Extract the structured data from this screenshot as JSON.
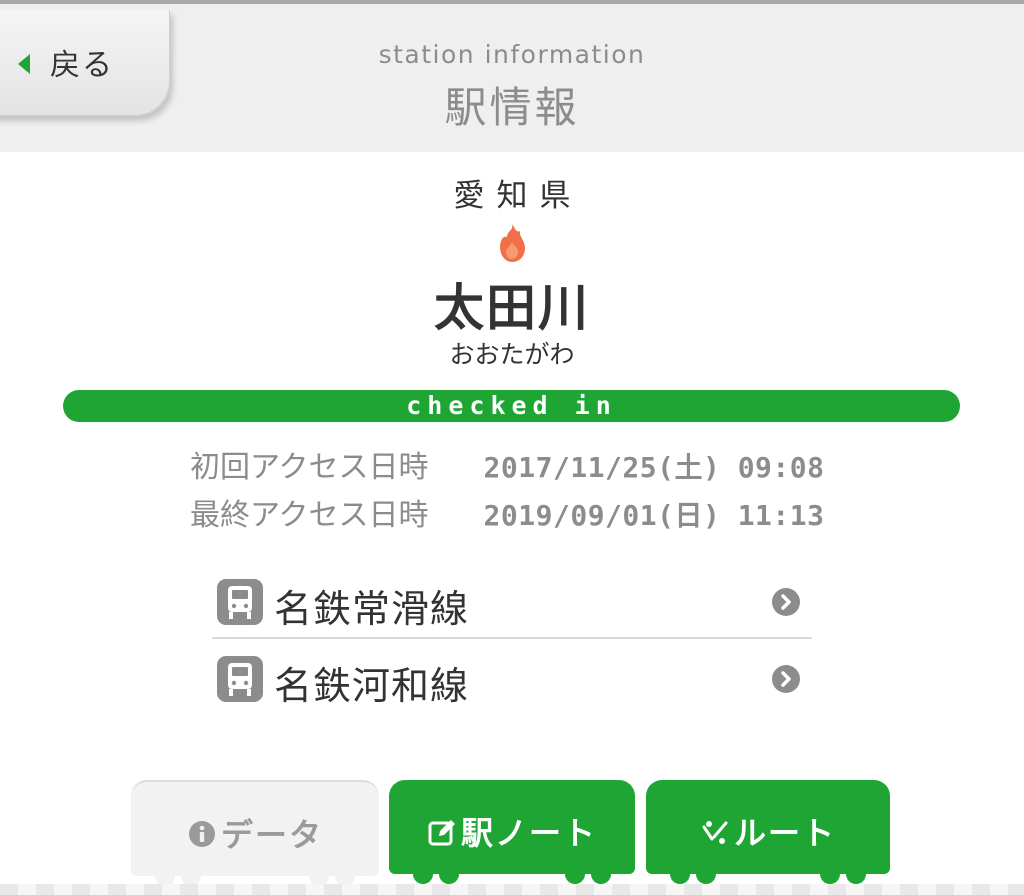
{
  "header": {
    "back_label": "戻る",
    "subtitle": "station information",
    "title": "駅情報"
  },
  "station": {
    "prefecture": "愛知県",
    "name": "太田川",
    "reading": "おおたがわ",
    "status": "checked in"
  },
  "access": {
    "first_label": "初回アクセス日時",
    "first_value": "2017/11/25(土) 09:08",
    "last_label": "最終アクセス日時",
    "last_value": "2019/09/01(日) 11:13"
  },
  "lines": [
    {
      "label": "名鉄常滑線",
      "icon": "train-icon"
    },
    {
      "label": "名鉄河和線",
      "icon": "train-icon"
    }
  ],
  "tabs": {
    "data_label": "データ",
    "note_label": "駅ノート",
    "route_label": "ルート"
  },
  "colors": {
    "accent": "#1ea534",
    "flame": "#f0704a",
    "muted_text": "#8c8c8c",
    "text": "#333333"
  }
}
